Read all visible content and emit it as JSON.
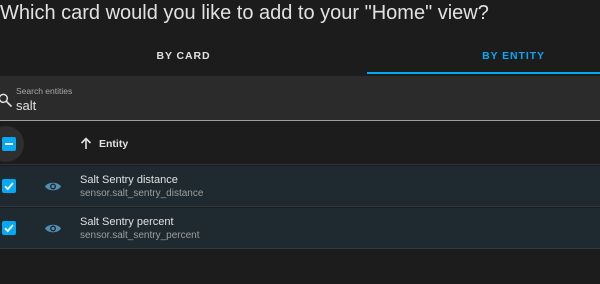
{
  "dialog": {
    "title": "Which card would you like to add to your \"Home\" view?"
  },
  "tabs": [
    {
      "label": "BY CARD",
      "selected": false
    },
    {
      "label": "BY ENTITY",
      "selected": true
    }
  ],
  "search": {
    "label": "Search entities",
    "value": "salt",
    "icon": "search-icon"
  },
  "table": {
    "header": {
      "select_all_state": "indeterminate",
      "column_label": "Entity",
      "sort_icon": "arrow-up-icon"
    },
    "rows": [
      {
        "name": "Salt Sentry distance",
        "entity_id": "sensor.salt_sentry_distance",
        "checked": true,
        "icon": "eye-icon"
      },
      {
        "name": "Salt Sentry percent",
        "entity_id": "sensor.salt_sentry_percent",
        "checked": true,
        "icon": "eye-icon"
      }
    ]
  },
  "colors": {
    "accent": "#03a9f4",
    "background": "#1c1c1c",
    "row_background": "#1e2a2f",
    "eye_icon": "#4f8fb3"
  }
}
